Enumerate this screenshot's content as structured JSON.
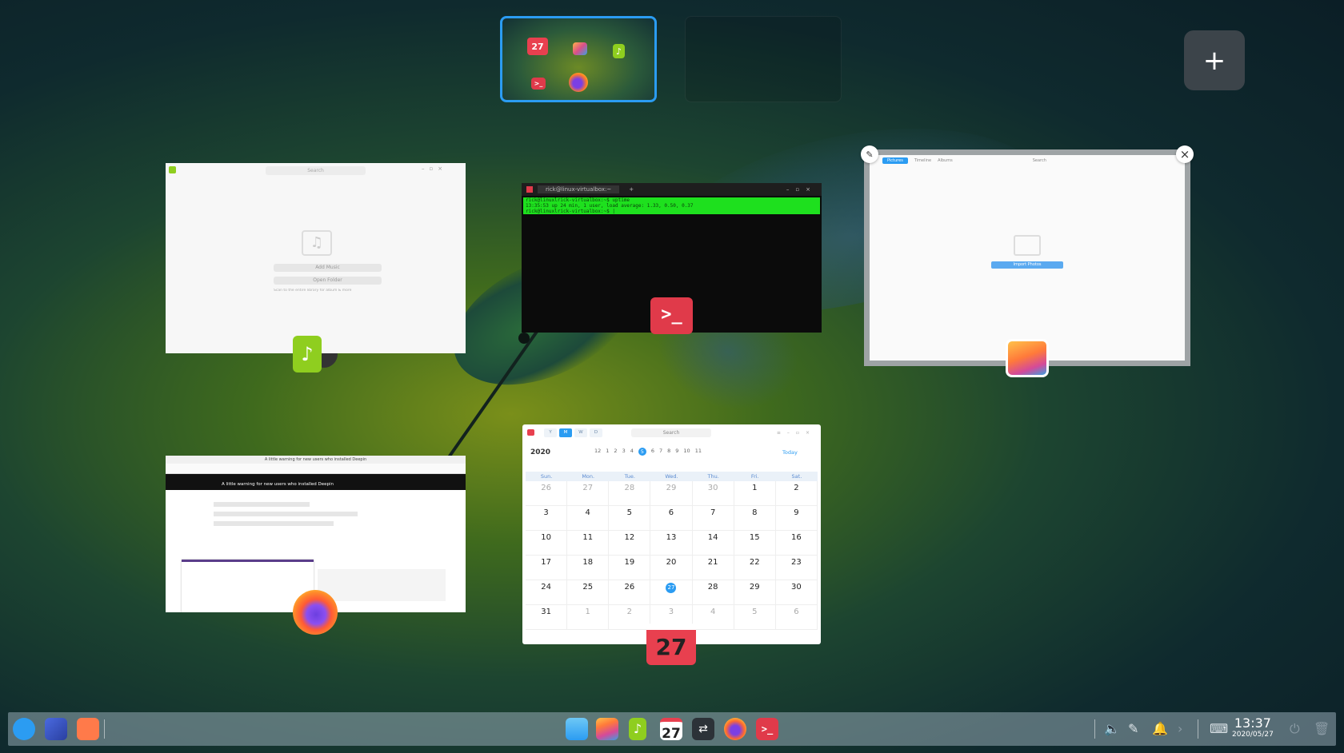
{
  "workspaces": {
    "add_label": "+"
  },
  "music": {
    "search_placeholder": "Search",
    "add_music": "Add Music",
    "open_folder": "Open Folder",
    "hint": "Scan to the entire library for album & more"
  },
  "terminal": {
    "tab_title": "rick@linux-virtualbox:~",
    "lines": [
      "rick@linuxlrick-virtualbox:~$ uptime",
      " 13:35:53 up 24 min,  1 user,  load average: 1.33, 0.50, 0.37",
      "rick@linuxlrick-virtualbox:~$ |"
    ]
  },
  "album": {
    "tabs": [
      "Pictures",
      "Timeline",
      "Albums"
    ],
    "search_placeholder": "Search",
    "import_label": "Import Photos"
  },
  "firefox": {
    "window_title": "A little warning for new users who installed Deepin",
    "post_title": "A little warning for new users who installed Deepin"
  },
  "calendar": {
    "view_buttons": [
      "Y",
      "M",
      "W",
      "D"
    ],
    "search_placeholder": "Search",
    "year": "2020",
    "months": [
      "12",
      "1",
      "2",
      "3",
      "4",
      "5",
      "6",
      "7",
      "8",
      "9",
      "10",
      "11"
    ],
    "today_label": "Today",
    "weekdays": [
      "Sun.",
      "Mon.",
      "Tue.",
      "Wed.",
      "Thu.",
      "Fri.",
      "Sat."
    ],
    "weeks": [
      [
        "26",
        "27",
        "28",
        "29",
        "30",
        "1",
        "2"
      ],
      [
        "3",
        "4",
        "5",
        "6",
        "7",
        "8",
        "9"
      ],
      [
        "10",
        "11",
        "12",
        "13",
        "14",
        "15",
        "16"
      ],
      [
        "17",
        "18",
        "19",
        "20",
        "21",
        "22",
        "23"
      ],
      [
        "24",
        "25",
        "26",
        "27",
        "28",
        "29",
        "30"
      ],
      [
        "31",
        "1",
        "2",
        "3",
        "4",
        "5",
        "6"
      ]
    ],
    "icon_day": "27"
  },
  "dock": {
    "calendar_day": "27"
  },
  "clock": {
    "time": "13:37",
    "date": "2020/05/27"
  },
  "colors": {
    "accent": "#2b9cf2",
    "terminal_red": "#e03a4a",
    "music_green": "#8fce1f"
  }
}
